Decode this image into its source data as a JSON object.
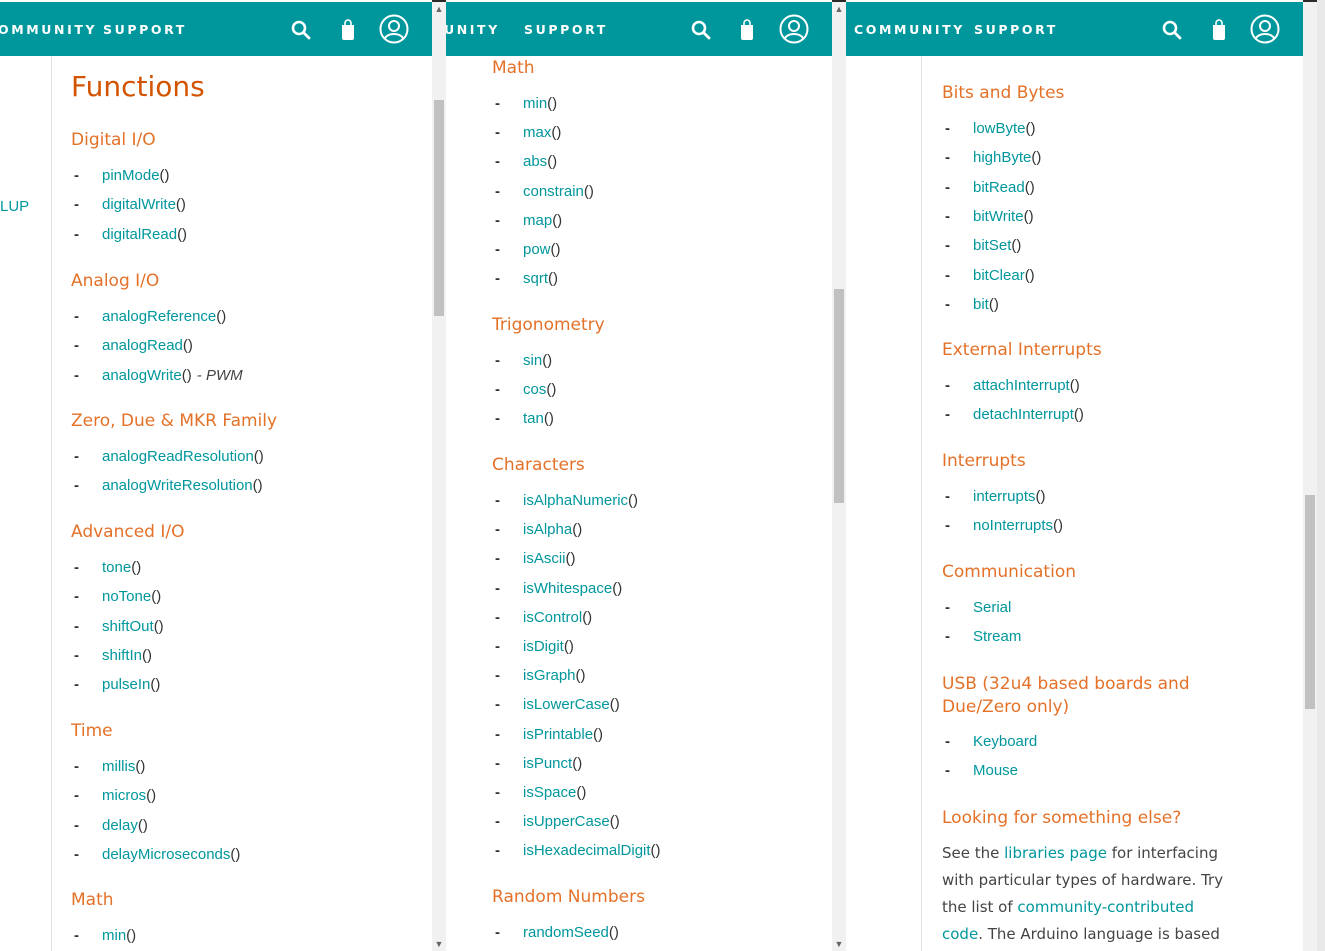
{
  "nav": {
    "community": "COMMUNITY",
    "support": "SUPPORT"
  },
  "icons": [
    "search-icon",
    "bag-icon",
    "user-account-icon"
  ],
  "colors": {
    "header": "#00979c",
    "heading": "#e47128",
    "link": "#00979c"
  },
  "left": {
    "nav_partial": "OMMUNITY",
    "sidebar_fragment": "LUP",
    "title": "Functions",
    "sections": [
      {
        "heading": "Digital I/O",
        "items": [
          "pinMode",
          "digitalWrite",
          "digitalRead"
        ]
      },
      {
        "heading": "Analog I/O",
        "items": [
          "analogReference",
          "analogRead",
          "analogWrite"
        ],
        "note": "- PWM"
      },
      {
        "heading": "Zero, Due & MKR Family",
        "items": [
          "analogReadResolution",
          "analogWriteResolution"
        ]
      },
      {
        "heading": "Advanced I/O",
        "items": [
          "tone",
          "noTone",
          "shiftOut",
          "shiftIn",
          "pulseIn"
        ]
      },
      {
        "heading": "Time",
        "items": [
          "millis",
          "micros",
          "delay",
          "delayMicroseconds"
        ]
      },
      {
        "heading": "Math",
        "items": [
          "min"
        ]
      }
    ]
  },
  "middle": {
    "nav_partial": "UNITY",
    "sections": [
      {
        "heading": "Math",
        "items": [
          "min",
          "max",
          "abs",
          "constrain",
          "map",
          "pow",
          "sqrt"
        ]
      },
      {
        "heading": "Trigonometry",
        "items": [
          "sin",
          "cos",
          "tan"
        ]
      },
      {
        "heading": "Characters",
        "items": [
          "isAlphaNumeric",
          "isAlpha",
          "isAscii",
          "isWhitespace",
          "isControl",
          "isDigit",
          "isGraph",
          "isLowerCase",
          "isPrintable",
          "isPunct",
          "isSpace",
          "isUpperCase",
          "isHexadecimalDigit"
        ]
      },
      {
        "heading": "Random Numbers",
        "items": [
          "randomSeed"
        ]
      }
    ]
  },
  "right": {
    "sections": [
      {
        "heading": "Bits and Bytes",
        "items": [
          "lowByte",
          "highByte",
          "bitRead",
          "bitWrite",
          "bitSet",
          "bitClear",
          "bit"
        ]
      },
      {
        "heading": "External Interrupts",
        "items": [
          "attachInterrupt",
          "detachInterrupt"
        ]
      },
      {
        "heading": "Interrupts",
        "items": [
          "interrupts",
          "noInterrupts"
        ]
      },
      {
        "heading": "Communication",
        "items": [
          "Serial",
          "Stream"
        ],
        "no_parens": true
      },
      {
        "heading": "USB (32u4 based boards and Due/Zero only)",
        "heading_lines": [
          "USB (32u4 based boards and",
          "Due/Zero only)"
        ],
        "items": [
          "Keyboard",
          "Mouse"
        ],
        "no_parens": true
      }
    ],
    "else_heading": "Looking for something else?",
    "else_text": {
      "p1": "See the ",
      "l1": "libraries page",
      "p2": " for interfacing with particular types of hardware. Try the list of ",
      "l2": "community-contributed code",
      "p3": ". The Arduino language is based on C/C++. It"
    }
  },
  "scroll": {
    "left_thumb": 0.24,
    "middle_thumb": 0.31,
    "right_thumb": 0.55
  }
}
